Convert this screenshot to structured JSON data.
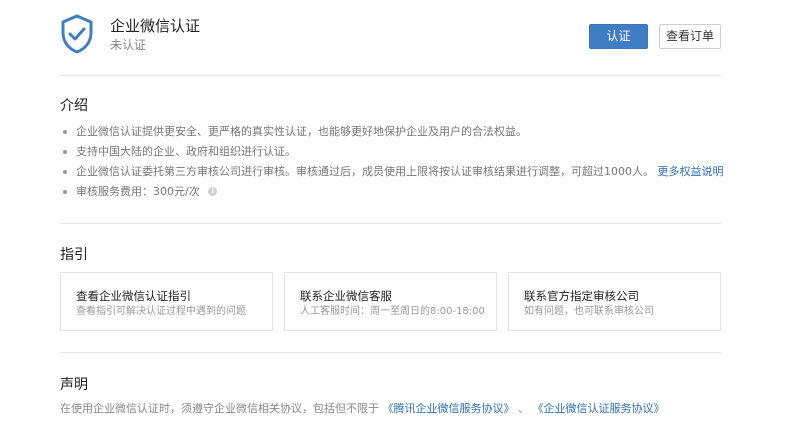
{
  "header": {
    "title": "企业微信认证",
    "status": "未认证",
    "primary_button": "认证",
    "secondary_button": "查看订单",
    "shield_icon": "shield-check-icon",
    "accent_color": "#3f7dc4"
  },
  "intro": {
    "title": "介绍",
    "items": [
      "企业微信认证提供更安全、更严格的真实性认证，也能够更好地保护企业及用户的合法权益。",
      "支持中国大陆的企业、政府和组织进行认证。",
      "企业微信认证委托第三方审核公司进行审核。审核通过后，成员使用上限将按认证审核结果进行调整，可超过1000人。",
      "审核服务费用：300元/次"
    ],
    "more_link": "更多权益说明",
    "info_icon": "info-icon"
  },
  "guide": {
    "title": "指引",
    "cards": [
      {
        "title": "查看企业微信认证指引",
        "desc": "查看指引可解决认证过程中遇到的问题"
      },
      {
        "title": "联系企业微信客服",
        "desc": "人工客服时间：周一至周日的8:00-18:00"
      },
      {
        "title": "联系官方指定审核公司",
        "desc": "如有问题，也可联系审核公司"
      }
    ]
  },
  "statement": {
    "title": "声明",
    "text": "在使用企业微信认证时，须遵守企业微信相关协议，包括但不限于",
    "link1": "《腾讯企业微信服务协议》",
    "separator": "、",
    "link2": "《企业微信认证服务协议》"
  }
}
